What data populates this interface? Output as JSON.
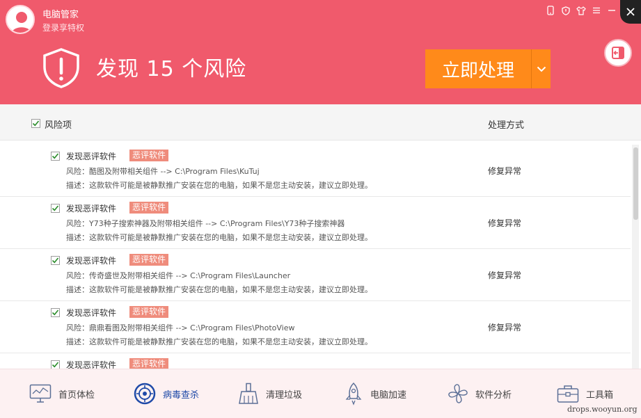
{
  "header": {
    "app_title": "电脑管家",
    "login_link": "登录享特权",
    "risk_heading": "发现 15 个风险",
    "handle_button": "立即处理"
  },
  "columns": {
    "risk_item": "风险项",
    "action": "处理方式"
  },
  "items": [
    {
      "title": "发现恶评软件",
      "tag": "恶评软件",
      "risk": "风险：酷图及附带相关组件 --> C:\\Program Files\\KuTuj",
      "desc": "描述：这款软件可能是被静默推广安装在您的电脑，如果不是您主动安装，建议立即处理。",
      "action": "修复异常"
    },
    {
      "title": "发现恶评软件",
      "tag": "恶评软件",
      "risk": "风险：Y73种子搜索神器及附带相关组件 --> C:\\Program Files\\Y73种子搜索神器",
      "desc": "描述：这款软件可能是被静默推广安装在您的电脑，如果不是您主动安装，建议立即处理。",
      "action": "修复异常"
    },
    {
      "title": "发现恶评软件",
      "tag": "恶评软件",
      "risk": "风险：传奇盛世及附带相关组件 --> C:\\Program Files\\Launcher",
      "desc": "描述：这款软件可能是被静默推广安装在您的电脑，如果不是您主动安装，建议立即处理。",
      "action": "修复异常"
    },
    {
      "title": "发现恶评软件",
      "tag": "恶评软件",
      "risk": "风险：鼎鼎看图及附带相关组件 --> C:\\Program Files\\PhotoView",
      "desc": "描述：这款软件可能是被静默推广安装在您的电脑，如果不是您主动安装，建议立即处理。",
      "action": "修复异常"
    },
    {
      "title": "发现恶评软件",
      "tag": "恶评软件",
      "risk": "",
      "desc": "",
      "action": ""
    }
  ],
  "nav": [
    {
      "label": "首页体检",
      "icon": "monitor-icon"
    },
    {
      "label": "病毒查杀",
      "icon": "virus-scan-icon"
    },
    {
      "label": "清理垃圾",
      "icon": "broom-icon"
    },
    {
      "label": "电脑加速",
      "icon": "rocket-icon"
    },
    {
      "label": "软件分析",
      "icon": "fan-icon"
    },
    {
      "label": "工具箱",
      "icon": "toolbox-icon"
    }
  ],
  "watermark": "drops.wooyun.org",
  "colors": {
    "header_bg": "#f05a6c",
    "primary_button": "#ff8a1a",
    "tag_bg": "#ef8c7c",
    "nav_active": "#1f4aa8"
  }
}
